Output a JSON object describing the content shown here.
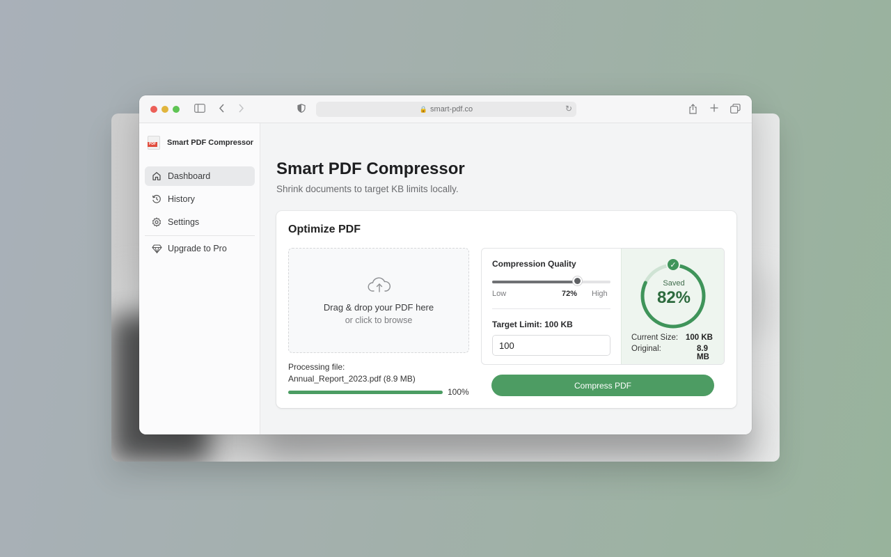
{
  "browser": {
    "url": "smart-pdf.co"
  },
  "sidebar": {
    "brand": "Smart PDF Compressor",
    "items": [
      {
        "label": "Dashboard",
        "icon": "home-icon",
        "active": true
      },
      {
        "label": "History",
        "icon": "history-icon"
      },
      {
        "label": "Settings",
        "icon": "gear-icon"
      }
    ],
    "upgrade": {
      "label": "Upgrade to Pro",
      "icon": "diamond-icon"
    }
  },
  "main": {
    "title": "Smart PDF Compressor",
    "subtitle": "Shrink documents to target KB limits locally."
  },
  "card": {
    "title": "Optimize PDF",
    "dropzone": {
      "main": "Drag & drop your PDF here",
      "sub": "or click to browse",
      "icon": "cloud-upload-icon"
    },
    "processing": {
      "label": "Processing file:",
      "file": "Annual_Report_2023.pdf (8.9 MB)",
      "progress": 100,
      "progress_text": "100%"
    },
    "settings": {
      "quality_label": "Compression Quality",
      "quality_value": 72,
      "quality_text": "72%",
      "low_label": "Low",
      "high_label": "High",
      "target_label": "Target Limit: 100 KB",
      "target_value": "100",
      "target_unit": "KB"
    },
    "result": {
      "saved_label": "Saved",
      "saved_value": "82%",
      "saved_fraction": 0.82,
      "current_label": "Current Size:",
      "current_value": "100 KB",
      "original_label": "Original:",
      "original_value": "8.9 MB"
    },
    "compress_button": "Compress PDF"
  },
  "colors": {
    "accent_green": "#4d9c63",
    "ring_green": "#3f945a",
    "pdf_red": "#e04b3c"
  }
}
